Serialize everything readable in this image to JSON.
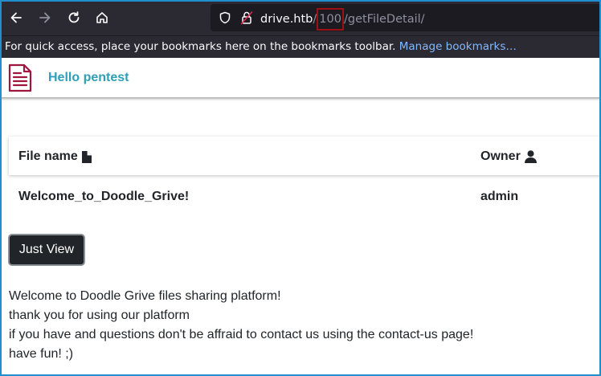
{
  "browser": {
    "url_host": "drive.htb",
    "url_sep1": "/",
    "url_id": "100",
    "url_sep2": "/",
    "url_path": "getFileDetail/"
  },
  "bookmarks": {
    "hint": "For quick access, place your bookmarks here on the bookmarks toolbar.",
    "manage_link": "Manage bookmarks…"
  },
  "header": {
    "greeting": "Hello pentest"
  },
  "table": {
    "columns": {
      "file": "File name",
      "owner": "Owner"
    },
    "rows": [
      {
        "file": "Welcome_to_Doodle_Grive!",
        "owner": "admin"
      }
    ]
  },
  "view_button_label": "Just View",
  "file_content": [
    "Welcome to Doodle Grive files sharing platform!",
    "thank you for using our platform",
    "if you have and questions don't be affraid to contact us using the contact-us page!",
    "have fun! ;)"
  ],
  "colors": {
    "accent": "#2f9fb8",
    "logo": "#a0153e",
    "highlight_box": "#9b1116"
  }
}
